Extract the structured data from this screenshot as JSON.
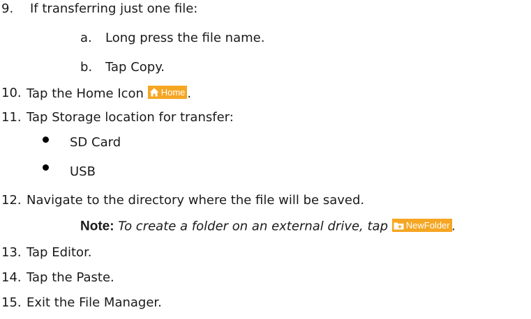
{
  "steps": [
    {
      "num": "9.",
      "text": "If transferring just one file:"
    },
    {
      "num": "a.",
      "text": "Long press the file name."
    },
    {
      "num": "b.",
      "text": "Tap Copy."
    },
    {
      "num": "10.",
      "text": "Tap the Home Icon",
      "chip": "Home",
      "trail": "."
    },
    {
      "num": "11.",
      "text": "Tap Storage location for transfer:"
    },
    {
      "text": "SD Card"
    },
    {
      "text": "USB"
    },
    {
      "num": "12.",
      "text": "Navigate to the directory where the file will be saved."
    },
    {
      "num": "13.",
      "text": "Tap Editor."
    },
    {
      "num": "14.",
      "text": "Tap the Paste."
    },
    {
      "num": "15.",
      "text": "Exit the File Manager."
    }
  ],
  "note": {
    "label": "Note:",
    "text": "To create a folder on an external drive, tap",
    "chip": "NewFolder",
    "trail": "."
  },
  "colors": {
    "chip_background": "#f5a623",
    "chip_text": "#ffffff",
    "body_text": "#1a1a1a"
  },
  "icons": [
    "home-icon",
    "new-folder-icon"
  ]
}
